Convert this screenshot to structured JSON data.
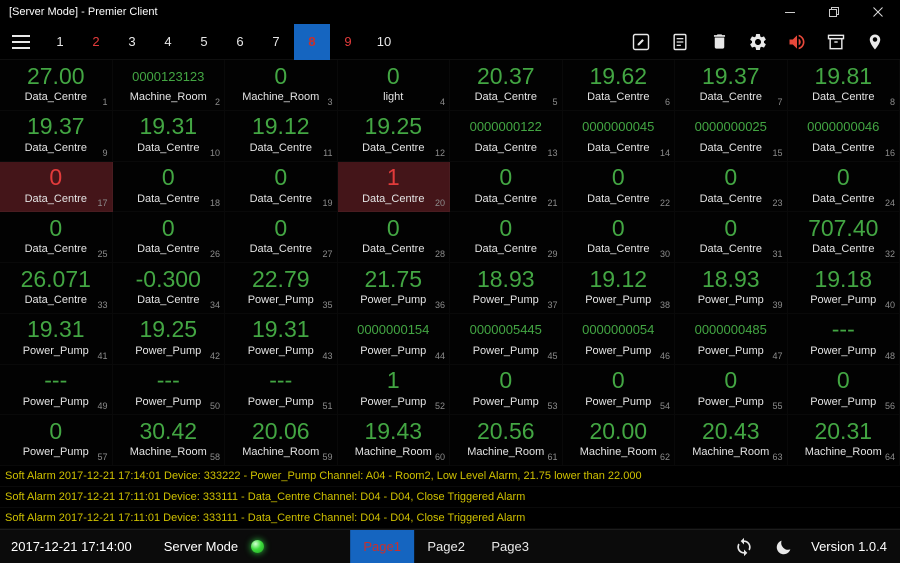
{
  "window": {
    "title": "[Server Mode] - Premier Client"
  },
  "colors": {
    "value_green": "#43a643",
    "value_red": "#e23b3b",
    "alarm_cell_bg": "#441519",
    "selected_blue": "#1565c0",
    "alarm_text_yellow": "#cfc100",
    "speaker_red": "#e8483a",
    "led_green": "#3ddc3d"
  },
  "toolbar": {
    "pages": [
      {
        "label": "1",
        "state": "normal"
      },
      {
        "label": "2",
        "state": "red"
      },
      {
        "label": "3",
        "state": "normal"
      },
      {
        "label": "4",
        "state": "normal"
      },
      {
        "label": "5",
        "state": "normal"
      },
      {
        "label": "6",
        "state": "normal"
      },
      {
        "label": "7",
        "state": "normal"
      },
      {
        "label": "8",
        "state": "selected"
      },
      {
        "label": "9",
        "state": "red"
      },
      {
        "label": "10",
        "state": "normal"
      }
    ],
    "icons": [
      "menu-icon",
      "edit-icon",
      "report-icon",
      "delete-icon",
      "settings-icon",
      "alarm-sound-icon",
      "clear-alarms-icon",
      "location-icon"
    ]
  },
  "grid": {
    "cells": [
      {
        "index": "1",
        "value": "27.00",
        "label": "Data_Centre"
      },
      {
        "index": "2",
        "value": "0000123123",
        "label": "Machine_Room",
        "small": true
      },
      {
        "index": "3",
        "value": "0",
        "label": "Machine_Room"
      },
      {
        "index": "4",
        "value": "0",
        "label": "light"
      },
      {
        "index": "5",
        "value": "20.37",
        "label": "Data_Centre"
      },
      {
        "index": "6",
        "value": "19.62",
        "label": "Data_Centre"
      },
      {
        "index": "7",
        "value": "19.37",
        "label": "Data_Centre"
      },
      {
        "index": "8",
        "value": "19.81",
        "label": "Data_Centre"
      },
      {
        "index": "9",
        "value": "19.37",
        "label": "Data_Centre"
      },
      {
        "index": "10",
        "value": "19.31",
        "label": "Data_Centre"
      },
      {
        "index": "11",
        "value": "19.12",
        "label": "Data_Centre"
      },
      {
        "index": "12",
        "value": "19.25",
        "label": "Data_Centre"
      },
      {
        "index": "13",
        "value": "0000000122",
        "label": "Data_Centre",
        "small": true
      },
      {
        "index": "14",
        "value": "0000000045",
        "label": "Data_Centre",
        "small": true
      },
      {
        "index": "15",
        "value": "0000000025",
        "label": "Data_Centre",
        "small": true
      },
      {
        "index": "16",
        "value": "0000000046",
        "label": "Data_Centre",
        "small": true
      },
      {
        "index": "17",
        "value": "0",
        "label": "Data_Centre",
        "red": true,
        "alarm": true
      },
      {
        "index": "18",
        "value": "0",
        "label": "Data_Centre"
      },
      {
        "index": "19",
        "value": "0",
        "label": "Data_Centre"
      },
      {
        "index": "20",
        "value": "1",
        "label": "Data_Centre",
        "red": true,
        "alarm": true
      },
      {
        "index": "21",
        "value": "0",
        "label": "Data_Centre"
      },
      {
        "index": "22",
        "value": "0",
        "label": "Data_Centre"
      },
      {
        "index": "23",
        "value": "0",
        "label": "Data_Centre"
      },
      {
        "index": "24",
        "value": "0",
        "label": "Data_Centre"
      },
      {
        "index": "25",
        "value": "0",
        "label": "Data_Centre"
      },
      {
        "index": "26",
        "value": "0",
        "label": "Data_Centre"
      },
      {
        "index": "27",
        "value": "0",
        "label": "Data_Centre"
      },
      {
        "index": "28",
        "value": "0",
        "label": "Data_Centre"
      },
      {
        "index": "29",
        "value": "0",
        "label": "Data_Centre"
      },
      {
        "index": "30",
        "value": "0",
        "label": "Data_Centre"
      },
      {
        "index": "31",
        "value": "0",
        "label": "Data_Centre"
      },
      {
        "index": "32",
        "value": "707.40",
        "label": "Data_Centre"
      },
      {
        "index": "33",
        "value": "26.071",
        "label": "Data_Centre"
      },
      {
        "index": "34",
        "value": "-0.300",
        "label": "Data_Centre"
      },
      {
        "index": "35",
        "value": "22.79",
        "label": "Power_Pump"
      },
      {
        "index": "36",
        "value": "21.75",
        "label": "Power_Pump"
      },
      {
        "index": "37",
        "value": "18.93",
        "label": "Power_Pump"
      },
      {
        "index": "38",
        "value": "19.12",
        "label": "Power_Pump"
      },
      {
        "index": "39",
        "value": "18.93",
        "label": "Power_Pump"
      },
      {
        "index": "40",
        "value": "19.18",
        "label": "Power_Pump"
      },
      {
        "index": "41",
        "value": "19.31",
        "label": "Power_Pump"
      },
      {
        "index": "42",
        "value": "19.25",
        "label": "Power_Pump"
      },
      {
        "index": "43",
        "value": "19.31",
        "label": "Power_Pump"
      },
      {
        "index": "44",
        "value": "0000000154",
        "label": "Power_Pump",
        "small": true
      },
      {
        "index": "45",
        "value": "0000005445",
        "label": "Power_Pump",
        "small": true
      },
      {
        "index": "46",
        "value": "0000000054",
        "label": "Power_Pump",
        "small": true
      },
      {
        "index": "47",
        "value": "0000000485",
        "label": "Power_Pump",
        "small": true
      },
      {
        "index": "48",
        "value": "---",
        "label": "Power_Pump"
      },
      {
        "index": "49",
        "value": "---",
        "label": "Power_Pump"
      },
      {
        "index": "50",
        "value": "---",
        "label": "Power_Pump"
      },
      {
        "index": "51",
        "value": "---",
        "label": "Power_Pump"
      },
      {
        "index": "52",
        "value": "1",
        "label": "Power_Pump"
      },
      {
        "index": "53",
        "value": "0",
        "label": "Power_Pump"
      },
      {
        "index": "54",
        "value": "0",
        "label": "Power_Pump"
      },
      {
        "index": "55",
        "value": "0",
        "label": "Power_Pump"
      },
      {
        "index": "56",
        "value": "0",
        "label": "Power_Pump"
      },
      {
        "index": "57",
        "value": "0",
        "label": "Power_Pump"
      },
      {
        "index": "58",
        "value": "30.42",
        "label": "Machine_Room"
      },
      {
        "index": "59",
        "value": "20.06",
        "label": "Machine_Room"
      },
      {
        "index": "60",
        "value": "19.43",
        "label": "Machine_Room"
      },
      {
        "index": "61",
        "value": "20.56",
        "label": "Machine_Room"
      },
      {
        "index": "62",
        "value": "20.00",
        "label": "Machine_Room"
      },
      {
        "index": "63",
        "value": "20.43",
        "label": "Machine_Room"
      },
      {
        "index": "64",
        "value": "20.31",
        "label": "Machine_Room"
      }
    ]
  },
  "alarms": [
    "Soft Alarm 2017-12-21 17:14:01 Device: 333222 - Power_Pump Channel: A04 - Room2, Low Level Alarm, 21.75 lower than 22.000",
    "Soft Alarm 2017-12-21 17:11:01 Device: 333111 - Data_Centre Channel: D04 - D04, Close Triggered Alarm",
    "Soft Alarm 2017-12-21 17:11:01 Device: 333111 - Data_Centre Channel: D04 - D04, Close Triggered Alarm"
  ],
  "statusbar": {
    "datetime": "2017-12-21 17:14:00",
    "mode_label": "Server Mode",
    "tabs": [
      {
        "label": "Page1",
        "selected": true
      },
      {
        "label": "Page2",
        "selected": false
      },
      {
        "label": "Page3",
        "selected": false
      }
    ],
    "version": "Version 1.0.4"
  }
}
